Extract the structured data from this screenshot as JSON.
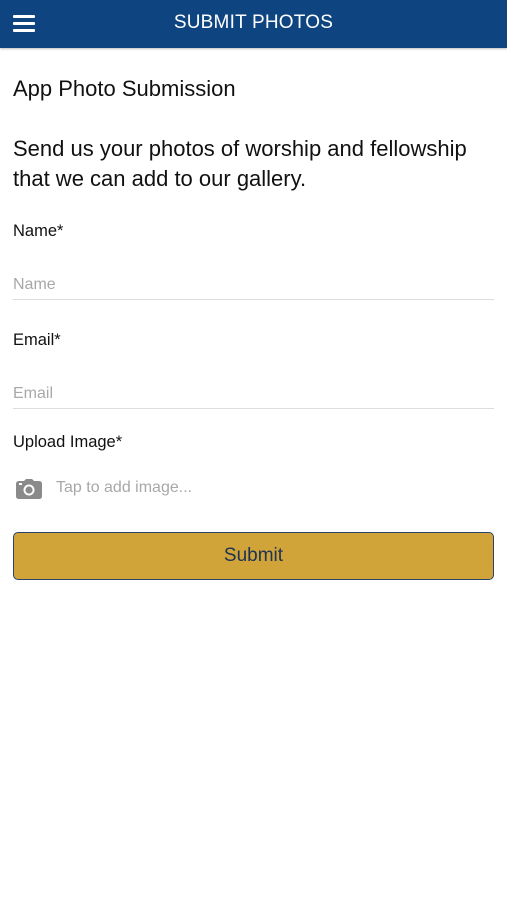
{
  "header": {
    "title": "SUBMIT PHOTOS",
    "menu_icon": "hamburger-menu-icon",
    "background_color": "#0e4580"
  },
  "form": {
    "heading": "App Photo Submission",
    "intro": "Send us your photos of worship and fellowship that we can add to our gallery.",
    "name": {
      "label": "Name*",
      "placeholder": "Name",
      "value": ""
    },
    "email": {
      "label": "Email*",
      "placeholder": "Email",
      "value": ""
    },
    "upload": {
      "label": "Upload Image*",
      "icon": "camera-icon",
      "prompt": "Tap to add image..."
    },
    "submit": {
      "label": "Submit",
      "color": "#d1a43a"
    }
  }
}
